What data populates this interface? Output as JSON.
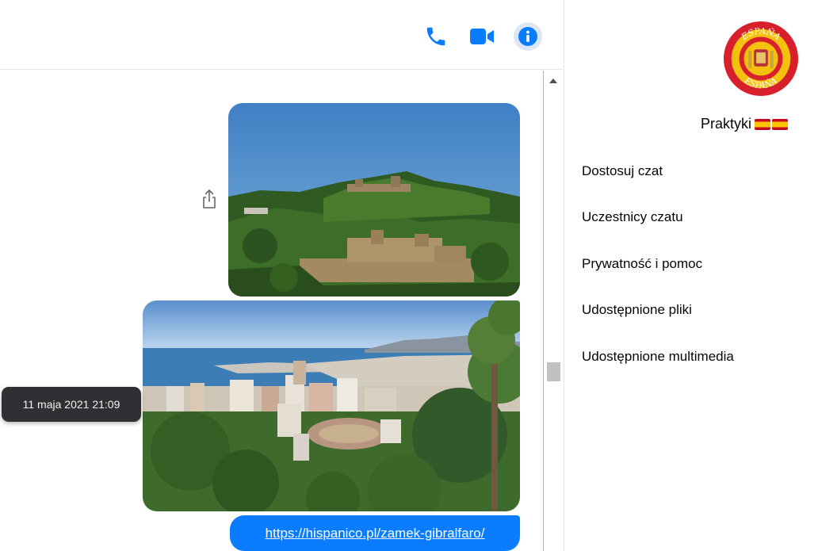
{
  "header": {
    "icons": [
      "phone-icon",
      "video-camera-icon",
      "info-icon"
    ],
    "accent_color": "#0a7cff"
  },
  "messages": {
    "timestamp": "11 maja 2021 21:09",
    "link_text": "https://hispanico.pl/zamek-gibralfaro/"
  },
  "side_panel": {
    "group_name": "Praktyki",
    "avatar_text_top": "ESPAÑA",
    "avatar_text_bottom": "ESPAÑA",
    "menu_items": [
      "Dostosuj czat",
      "Uczestnicy czatu",
      "Prywatność i pomoc",
      "Udostępnione pliki",
      "Udostępnione multimedia"
    ]
  },
  "colors": {
    "link_bubble": "#0a7cff",
    "tooltip_bg": "#2f3033"
  }
}
